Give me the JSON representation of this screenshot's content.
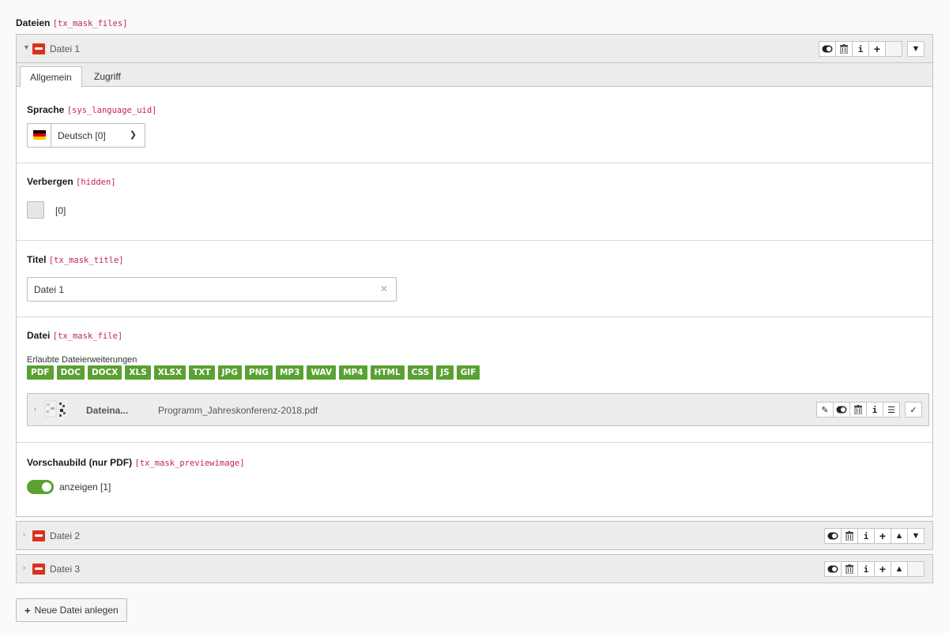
{
  "section": {
    "label": "Dateien",
    "code": "[tx_mask_files]"
  },
  "records": [
    {
      "title": "Datei 1",
      "controls": [
        "toggle-visibility-icon",
        "delete-icon",
        "info-icon",
        "add-icon",
        "",
        "move-down-icon"
      ]
    },
    {
      "title": "Datei 2",
      "controls": [
        "toggle-visibility-icon",
        "delete-icon",
        "info-icon",
        "add-icon",
        "move-up-icon",
        "move-down-icon"
      ]
    },
    {
      "title": "Datei 3",
      "controls": [
        "toggle-visibility-icon",
        "delete-icon",
        "info-icon",
        "add-icon",
        "move-up-icon",
        ""
      ]
    }
  ],
  "tabs": [
    "Allgemein",
    "Zugriff"
  ],
  "fields": {
    "language": {
      "label": "Sprache",
      "code": "[sys_language_uid]",
      "value": "Deutsch [0]",
      "flag": "de-flag"
    },
    "hidden": {
      "label": "Verbergen",
      "code": "[hidden]",
      "value": "[0]"
    },
    "title": {
      "label": "Titel",
      "code": "[tx_mask_title]",
      "value": "Datei 1"
    },
    "file": {
      "label": "Datei",
      "code": "[tx_mask_file]",
      "extensions_label": "Erlaubte Dateierweiterungen",
      "extensions": [
        "PDF",
        "DOC",
        "DOCX",
        "XLS",
        "XLSX",
        "TXT",
        "JPG",
        "PNG",
        "MP3",
        "WAV",
        "MP4",
        "HTML",
        "CSS",
        "JS",
        "GIF"
      ],
      "filename_label": "Dateina...",
      "filename": "Programm_Jahreskonferenz-2018.pdf"
    },
    "preview": {
      "label": "Vorschaubild (nur PDF)",
      "code": "[tx_mask_previewimage]",
      "toggle_label": "anzeigen [1]",
      "enabled": true
    }
  },
  "new_button": {
    "label": "Neue Datei anlegen"
  },
  "colors": {
    "accent_green": "#5aa132",
    "code_red": "#c7254e",
    "pdf_red": "#d9321f"
  }
}
